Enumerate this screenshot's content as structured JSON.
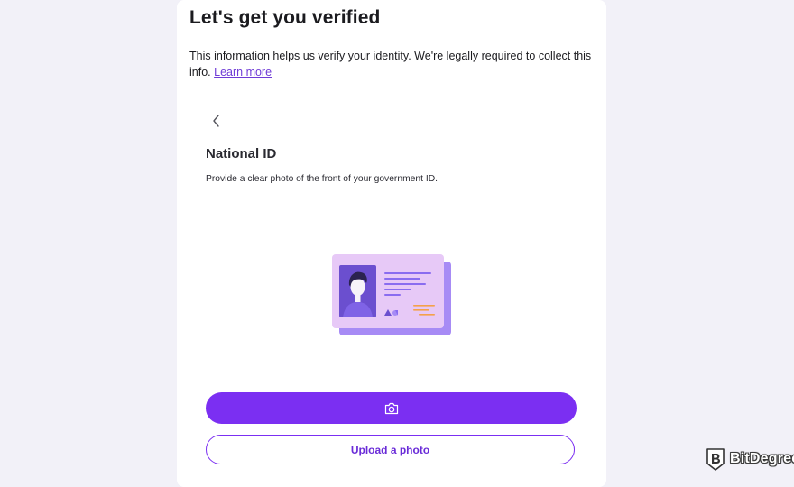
{
  "header": {
    "title": "Let's get you verified",
    "intro_text": "This information helps us verify your identity. We're legally required to collect this info.",
    "learn_more_label": "Learn more"
  },
  "document_step": {
    "back_icon": "chevron-left-icon",
    "title": "National ID",
    "description": "Provide a clear photo of the front of your government ID.",
    "illustration": "id-card-illustration"
  },
  "actions": {
    "camera_icon": "camera-icon",
    "upload_label": "Upload a photo"
  },
  "watermark": {
    "text": "BitDegree",
    "logo": "bitdegree-logo"
  },
  "colors": {
    "accent": "#7b2ff2",
    "background": "#f2f1f8",
    "card": "#ffffff",
    "link": "#6f3bd6"
  }
}
